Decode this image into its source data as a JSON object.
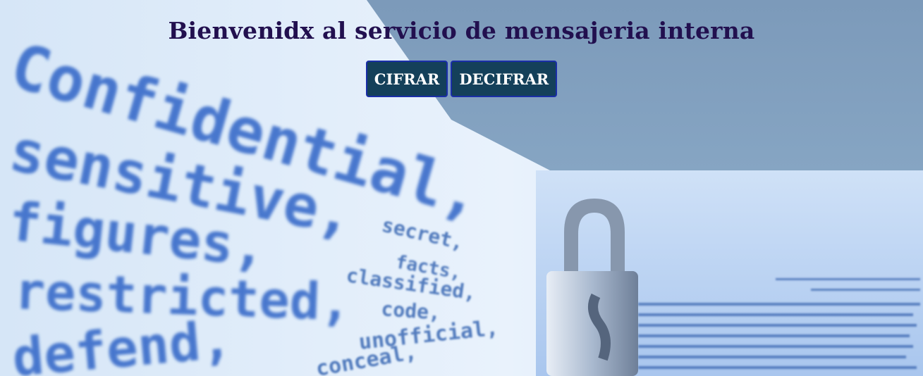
{
  "header": {
    "title": "Bienvenidx al servicio de mensajeria interna"
  },
  "actions": {
    "encrypt_label": "CIFRAR",
    "decrypt_label": "DECIFRAR"
  },
  "background": {
    "description_icon": "padlock-icon",
    "words": [
      "Confidential,",
      "sensitive,",
      "figures,",
      "restricted,",
      "defend,",
      "secret,",
      "facts,",
      "classified,",
      "code,",
      "unofficial,",
      "conceal,"
    ]
  },
  "colors": {
    "title": "#22104f",
    "button_bg": "#14405a",
    "button_border": "#1a2ea8",
    "button_text": "#ffffff",
    "bg_light": "#dce9f8",
    "bg_dark": "#7c9cbb",
    "text_blue": "#2d63c6"
  }
}
